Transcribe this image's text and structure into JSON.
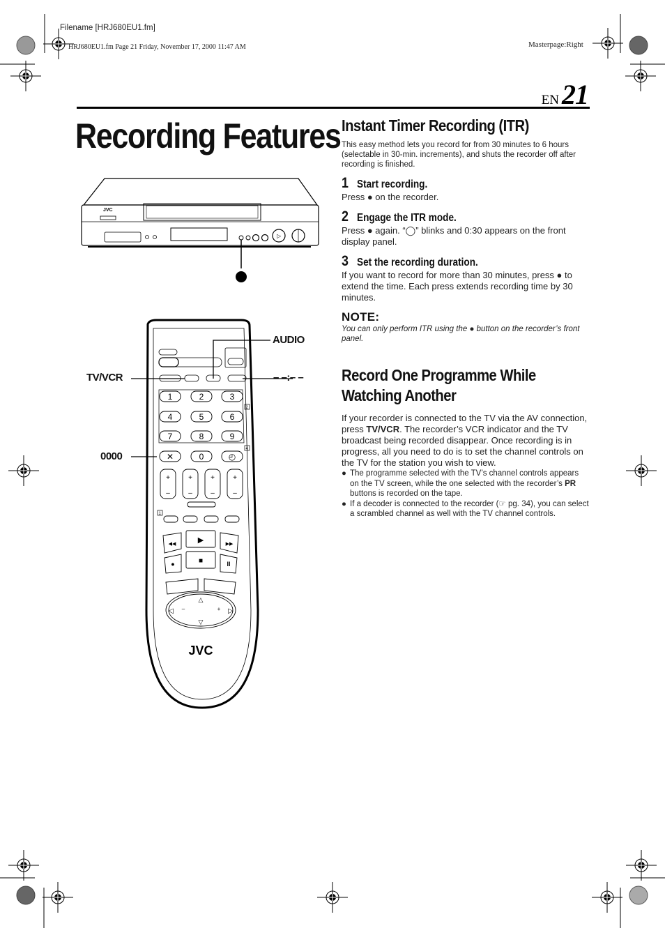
{
  "print_header": {
    "filename": "Filename [HRJ680EU1.fm]",
    "stamp": "HRJ680EU1.fm  Page 21  Friday, November 17, 2000  11:47 AM",
    "masterpage": "Masterpage:Right"
  },
  "page": {
    "lang": "EN",
    "number": "21"
  },
  "title": "Recording Features",
  "illustrations": {
    "vcr_brand": "JVC",
    "remote_brand": "JVC",
    "record_symbol": "●",
    "callouts": {
      "audio": "AUDIO",
      "tv_vcr": "TV/VCR",
      "counter_reset": "0000",
      "time_display": "– –:– –"
    },
    "keypad": [
      "1",
      "2",
      "3",
      "4",
      "5",
      "6",
      "7",
      "8",
      "9",
      "X",
      "0",
      "◴"
    ],
    "section_refs": [
      "2",
      "4",
      "1"
    ]
  },
  "itr": {
    "heading": "Instant Timer Recording (ITR)",
    "intro": "This easy method lets you record for from 30 minutes to 6 hours (selectable in 30-min. increments), and shuts the recorder off after recording is finished.",
    "steps": [
      {
        "num": "1",
        "title": "Start recording.",
        "body": "Press ● on the recorder."
      },
      {
        "num": "2",
        "title": "Engage the ITR mode.",
        "body": "Press ● again. “◯” blinks and 0:30 appears on the front display panel."
      },
      {
        "num": "3",
        "title": "Set the recording duration.",
        "body": "If you want to record for more than 30 minutes, press ● to extend the time. Each press extends recording time by 30 minutes."
      }
    ],
    "note_heading": "NOTE:",
    "note": "You can only perform ITR using the ● button on the recorder’s front panel."
  },
  "record_one": {
    "heading_line1": "Record One Programme While",
    "heading_line2": "Watching Another",
    "body_pre": "If your recorder is connected to the TV via the AV connection, press ",
    "body_bold": "TV/VCR",
    "body_post": ". The recorder’s VCR indicator and the TV broadcast being recorded disappear. Once recording is in progress, all you need to do is to set the channel controls on the TV for the station you wish to view.",
    "bullets": [
      {
        "pre": "The programme selected with the TV’s channel controls appears on the TV screen, while the one selected with the recorder’s ",
        "bold": "PR",
        "post": " buttons is recorded on the tape."
      },
      {
        "pre": "If a decoder is connected to the recorder (☞ pg. 34), you can select a scrambled channel as well with the TV channel controls.",
        "bold": "",
        "post": ""
      }
    ]
  }
}
